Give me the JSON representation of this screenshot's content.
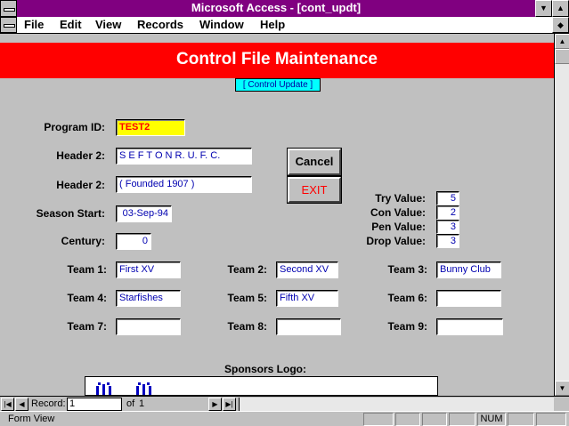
{
  "window": {
    "title": "Microsoft Access - [cont_updt]"
  },
  "menu": {
    "items": [
      "File",
      "Edit",
      "View",
      "Records",
      "Window",
      "Help"
    ]
  },
  "form": {
    "header_title": "Control File Maintenance",
    "control_update_button": "[ Control Update ]",
    "program_id_label": "Program ID:",
    "program_id_value": "TEST2",
    "header2a_label": "Header 2:",
    "header2a_value": "S E F T O N   R. U. F. C.",
    "header2b_label": "Header 2:",
    "header2b_value": "( Founded 1907 )",
    "season_start_label": "Season Start:",
    "season_start_value": "03-Sep-94",
    "century_label": "Century:",
    "century_value": "0",
    "cancel_label": "Cancel",
    "exit_label": "EXIT",
    "try_label": "Try Value:",
    "try_value": "5",
    "con_label": "Con Value:",
    "con_value": "2",
    "pen_label": "Pen Value:",
    "pen_value": "3",
    "drop_label": "Drop Value:",
    "drop_value": "3",
    "teams": [
      {
        "label": "Team 1:",
        "value": "First XV"
      },
      {
        "label": "Team 2:",
        "value": "Second XV"
      },
      {
        "label": "Team 3:",
        "value": "Bunny Club"
      },
      {
        "label": "Team 4:",
        "value": "Starfishes"
      },
      {
        "label": "Team 5:",
        "value": "Fifth XV"
      },
      {
        "label": "Team 6:",
        "value": ""
      },
      {
        "label": "Team 7:",
        "value": ""
      },
      {
        "label": "Team 8:",
        "value": ""
      },
      {
        "label": "Team 9:",
        "value": ""
      }
    ],
    "sponsors_label": "Sponsors Logo:"
  },
  "nav": {
    "record_label": "Record:",
    "record_value": "1",
    "of_label": "of",
    "of_value": "1"
  },
  "status": {
    "text": "Form View",
    "num": "NUM"
  },
  "colors": {
    "titlebar": "#800080",
    "header": "#ff0000",
    "field_text": "#0000b0",
    "accent_button": "#00ffff"
  }
}
